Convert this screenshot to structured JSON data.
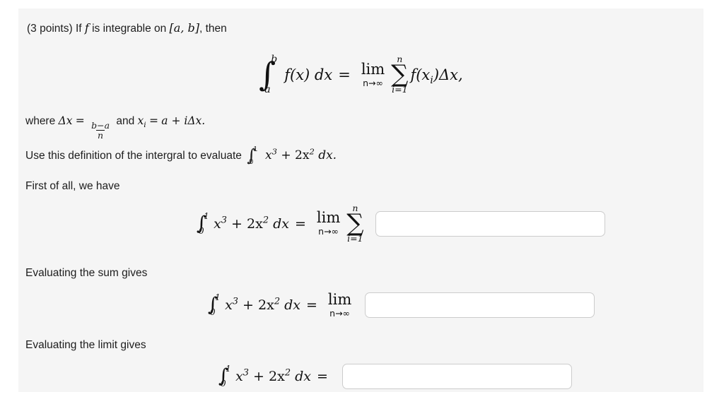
{
  "question": {
    "points_label": "(3 points)",
    "prompt_pre": "If",
    "prompt_f": "f",
    "prompt_mid": "is integrable on",
    "interval": "[a, b]",
    "prompt_end": ", then"
  },
  "definition": {
    "integral_symbol": "∫",
    "lower_limit": "a",
    "upper_limit": "b",
    "integrand": "f(x) dx",
    "equals": "=",
    "lim_label": "lim",
    "lim_sub": "n→∞",
    "sum_symbol": "∑",
    "sum_upper": "n",
    "sum_lower": "i=1",
    "summand": "f(x",
    "summand_sub": "i",
    "summand_post": ")Δx,"
  },
  "where_line": {
    "where": "where",
    "delta_x": "Δx",
    "equals": "=",
    "frac_num": "b−a",
    "frac_den": "n",
    "and": "and",
    "x_var": "x",
    "x_sub": "i",
    "equals2": "=",
    "rhs": "a + iΔx."
  },
  "instruction": {
    "text_before": "Use this definition of the intergral to evaluate",
    "integral_symbol": "∫",
    "lower_limit": "0",
    "upper_limit": "1",
    "integrand_base": "x",
    "integrand_exp": "3",
    "integrand_plus": " + 2x",
    "integrand_exp2": "2",
    "integrand_dx": " dx."
  },
  "labels": {
    "first": "First of all, we have",
    "sum": "Evaluating the sum gives",
    "limit": "Evaluating the limit gives"
  },
  "expression": {
    "integral_symbol": "∫",
    "lower_limit": "0",
    "upper_limit": "1",
    "base": "x",
    "exp1": "3",
    "plus": " + 2x",
    "exp2": "2",
    "dx": " dx",
    "equals": "=",
    "lim_label": "lim",
    "lim_sub": "n→∞",
    "sum_symbol": "∑",
    "sum_upper": "n",
    "sum_lower": "i=1"
  },
  "answers": [
    {
      "name": "sum-expression",
      "value": "",
      "placeholder": ""
    },
    {
      "name": "limit-expression",
      "value": "",
      "placeholder": ""
    },
    {
      "name": "final-value",
      "value": "",
      "placeholder": ""
    }
  ],
  "colors": {
    "panel_bg": "#f5f5f5",
    "page_bg": "#ffffff",
    "text": "#1d1d1d",
    "input_border": "#cccccc"
  }
}
